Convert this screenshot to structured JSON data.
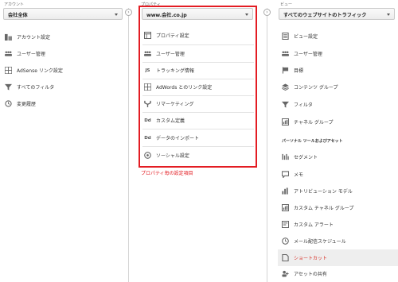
{
  "account": {
    "label": "アカウント",
    "select_value": "会社全体",
    "items": [
      {
        "label": "アカウント設定",
        "icon": "building-icon"
      },
      {
        "label": "ユーザー管理",
        "icon": "users-icon"
      },
      {
        "label": "AdSense リンク設定",
        "icon": "grid-icon"
      },
      {
        "label": "すべてのフィルタ",
        "icon": "filter-icon"
      },
      {
        "label": "変更履歴",
        "icon": "history-icon"
      }
    ]
  },
  "property": {
    "label": "プロパティ",
    "select_value": "www.会社.co.jp",
    "items": [
      {
        "label": "プロパティ設定",
        "icon": "window-icon"
      },
      {
        "label": "ユーザー管理",
        "icon": "users-icon"
      },
      {
        "label": "トラッキング情報",
        "icon": "js-icon",
        "glyph": "JS"
      },
      {
        "label": "AdWords とのリンク設定",
        "icon": "grid-icon"
      },
      {
        "label": "リマーケティング",
        "icon": "fork-icon"
      },
      {
        "label": "カスタム定義",
        "icon": "dd-icon",
        "glyph": "Dd"
      },
      {
        "label": "データのインポート",
        "icon": "dd-icon",
        "glyph": "Dd"
      },
      {
        "label": "ソーシャル設定",
        "icon": "social-icon"
      }
    ],
    "caption": "プロパティ毎の設定項目"
  },
  "view": {
    "label": "ビュー",
    "select_value": "すべてのウェブサイトのトラフィック",
    "items": [
      {
        "label": "ビュー設定",
        "icon": "document-icon"
      },
      {
        "label": "ユーザー管理",
        "icon": "users-icon"
      },
      {
        "label": "目標",
        "icon": "flag-icon"
      },
      {
        "label": "コンテンツ グループ",
        "icon": "stack-icon"
      },
      {
        "label": "フィルタ",
        "icon": "filter-icon"
      },
      {
        "label": "チャネル グループ",
        "icon": "channel-icon"
      }
    ],
    "section_heading": "パーソナル ツールおよびアセット",
    "personal_items": [
      {
        "label": "セグメント",
        "icon": "segment-icon"
      },
      {
        "label": "メモ",
        "icon": "memo-icon"
      },
      {
        "label": "アトリビューション モデル",
        "icon": "bars-icon"
      },
      {
        "label": "カスタム チャネル グループ",
        "icon": "channel-icon"
      },
      {
        "label": "カスタム アラート",
        "icon": "alert-icon"
      },
      {
        "label": "メール配信スケジュール",
        "icon": "clock-icon"
      },
      {
        "label": "ショートカット",
        "icon": "shortcut-icon",
        "active": true
      },
      {
        "label": "アセットの共有",
        "icon": "share-icon"
      }
    ]
  },
  "colors": {
    "highlight_red": "#e31c23",
    "active_item": "#d8332a"
  }
}
